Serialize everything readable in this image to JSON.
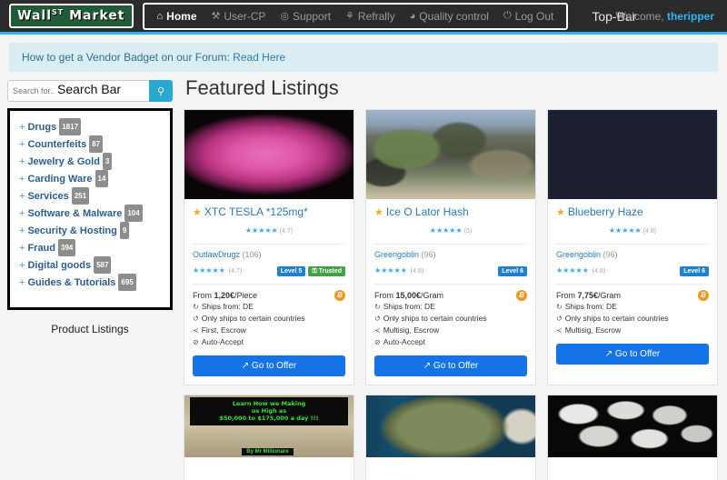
{
  "topbar": {
    "logo_text": "Wall",
    "logo_sup": "ST",
    "logo_text2": "Market",
    "nav": [
      {
        "label": "Home",
        "icon": "home-icon",
        "glyph": "⌂",
        "active": true
      },
      {
        "label": "User-CP",
        "icon": "tools-icon",
        "glyph": "⚒",
        "active": false
      },
      {
        "label": "Support",
        "icon": "lifebuoy-icon",
        "glyph": "◎",
        "active": false
      },
      {
        "label": "Refrally",
        "icon": "trophy-icon",
        "glyph": "⚘",
        "active": false
      },
      {
        "label": "Quality control",
        "icon": "shield-check-icon",
        "glyph": "◕",
        "active": false
      },
      {
        "label": "Log Out",
        "icon": "power-icon",
        "glyph": "⏻",
        "active": false
      }
    ],
    "annotation_label": "Top-Bar",
    "welcome_prefix": "Welcome,",
    "username": "theripper",
    "accent_color": "#29b6f6"
  },
  "notice": {
    "text": "How to get a Vendor Badget on our Forum:",
    "link_text": "Read Here"
  },
  "search": {
    "placeholder": "Search for..",
    "annotation_label": "Search Bar",
    "button_icon": "search-icon",
    "button_glyph": "⚲"
  },
  "sidebar": {
    "annotation_label": "Product Listings",
    "categories": [
      {
        "label": "Drugs",
        "count": "1817"
      },
      {
        "label": "Counterfeits",
        "count": "87"
      },
      {
        "label": "Jewelry & Gold",
        "count": "3"
      },
      {
        "label": "Carding Ware",
        "count": "14"
      },
      {
        "label": "Services",
        "count": "251"
      },
      {
        "label": "Software & Malware",
        "count": "104"
      },
      {
        "label": "Security & Hosting",
        "count": "9"
      },
      {
        "label": "Fraud",
        "count": "394"
      },
      {
        "label": "Digital goods",
        "count": "587"
      },
      {
        "label": "Guides & Tutorials",
        "count": "695"
      }
    ],
    "expand_symbol": "+"
  },
  "main": {
    "title": "Featured Listings",
    "cards": [
      {
        "image_name": "xtc-tesla-pink-pills-image",
        "image_class": "img-xtc",
        "title": "XTC TESLA *125mg*",
        "title_star": "★",
        "stars": "★★★★★",
        "rating": "(4.7)",
        "vendor_name": "OutlawDrugz",
        "vendor_count": "(106)",
        "vendor_stars": "★★★★★",
        "vendor_rating": "(4.7)",
        "level_badge": "Level 5",
        "trusted_badge": "⚿ Trusted",
        "price_prefix": "From",
        "price": "1,20€",
        "price_unit": "/Piece",
        "currency_icon": "bitcoin-icon",
        "currency_glyph": "Ƀ",
        "meta": [
          {
            "icon": "ships-from-icon",
            "glyph": "↻",
            "text": "Ships from: DE"
          },
          {
            "icon": "ships-to-icon",
            "glyph": "↺",
            "text": "Only ships to certain countries"
          },
          {
            "icon": "escrow-icon",
            "glyph": "≺",
            "text": "First, Escrow"
          },
          {
            "icon": "auto-accept-icon",
            "glyph": "⊘",
            "text": "Auto-Accept"
          }
        ],
        "button_label": "↗ Go to Offer"
      },
      {
        "image_name": "ice-o-lator-hash-image",
        "image_class": "img-hash",
        "title": "Ice O Lator Hash",
        "title_star": "★",
        "stars": "★★★★★",
        "rating": "(5)",
        "vendor_name": "Greengoblin",
        "vendor_count": "(96)",
        "vendor_stars": "★★★★★",
        "vendor_rating": "(4.8)",
        "level_badge": "Level 6",
        "trusted_badge": "",
        "price_prefix": "From",
        "price": "15,00€",
        "price_unit": "/Gram",
        "currency_icon": "bitcoin-icon",
        "currency_glyph": "Ƀ",
        "meta": [
          {
            "icon": "ships-from-icon",
            "glyph": "↻",
            "text": "Ships from: DE"
          },
          {
            "icon": "ships-to-icon",
            "glyph": "↺",
            "text": "Only ships to certain countries"
          },
          {
            "icon": "escrow-icon",
            "glyph": "≺",
            "text": "Multisig, Escrow"
          },
          {
            "icon": "auto-accept-icon",
            "glyph": "⊘",
            "text": "Auto-Accept"
          }
        ],
        "button_label": "↗ Go to Offer"
      },
      {
        "image_name": "blueberry-haze-bud-image",
        "image_class": "img-haze",
        "title": "Blueberry Haze",
        "title_star": "★",
        "stars": "★★★★★",
        "rating": "(4.8)",
        "vendor_name": "Greengoblin",
        "vendor_count": "(96)",
        "vendor_stars": "★★★★★",
        "vendor_rating": "(4.8)",
        "level_badge": "Level 6",
        "trusted_badge": "",
        "price_prefix": "From",
        "price": "7,75€",
        "price_unit": "/Gram",
        "currency_icon": "bitcoin-icon",
        "currency_glyph": "Ƀ",
        "meta": [
          {
            "icon": "ships-from-icon",
            "glyph": "↻",
            "text": "Ships from: DE"
          },
          {
            "icon": "ships-to-icon",
            "glyph": "↺",
            "text": "Only ships to certain countries"
          },
          {
            "icon": "escrow-icon",
            "glyph": "≺",
            "text": "Multisig, Escrow"
          }
        ],
        "button_label": "↗ Go to Offer"
      }
    ],
    "bottom_cards": [
      {
        "image_name": "money-banner-image",
        "image_class": "img-money",
        "banner_lines": [
          "Learn How we Making",
          "us High as",
          "$50,000 to $175,000 a day !!!"
        ],
        "banner_signature": "By Mr Millionare"
      },
      {
        "image_name": "cannabis-bud-image",
        "image_class": "img-weed",
        "banner_lines": [],
        "banner_signature": ""
      },
      {
        "image_name": "white-rocks-image",
        "image_class": "img-rocks",
        "banner_lines": [],
        "banner_signature": ""
      }
    ]
  }
}
